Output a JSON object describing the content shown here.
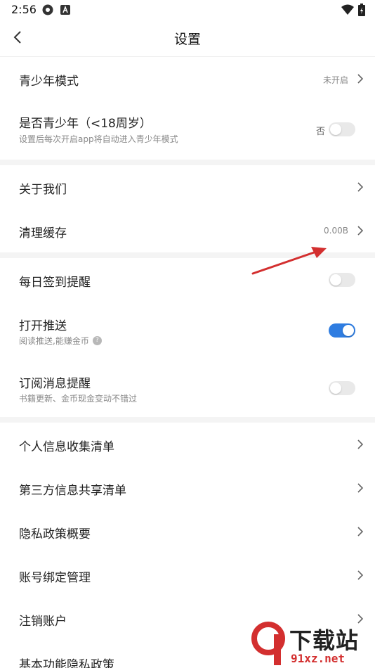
{
  "status_bar": {
    "time": "2:56",
    "icons": [
      "settings-app-icon",
      "a-app-icon",
      "wifi-icon",
      "battery-icon"
    ]
  },
  "nav": {
    "title": "设置",
    "back_icon": "chevron-left-icon"
  },
  "section1": {
    "youth_mode": {
      "label": "青少年模式",
      "value": "未开启"
    },
    "is_minor": {
      "label": "是否青少年（<18周岁）",
      "sub": "设置后每次开启app将自动进入青少年模式",
      "toggle_label": "否",
      "on": false
    }
  },
  "section2": {
    "about": {
      "label": "关于我们"
    },
    "clear_cache": {
      "label": "清理缓存",
      "value": "0.00B"
    }
  },
  "section3": {
    "daily_signin": {
      "label": "每日签到提醒",
      "on": false
    },
    "push": {
      "label": "打开推送",
      "sub": "阅读推送,能赚金币",
      "on": true
    },
    "subscribe": {
      "label": "订阅消息提醒",
      "sub": "书籍更新、金币现金变动不错过",
      "on": false
    }
  },
  "section4": {
    "items": [
      "个人信息收集清单",
      "第三方信息共享清单",
      "隐私政策概要",
      "账号绑定管理",
      "注销账户",
      "基本功能隐私政策"
    ]
  },
  "watermark": {
    "top": "下载站",
    "bottom": "91xz.net"
  },
  "colors": {
    "accent": "#2f7de1",
    "annotation_arrow": "#d32f2f"
  }
}
